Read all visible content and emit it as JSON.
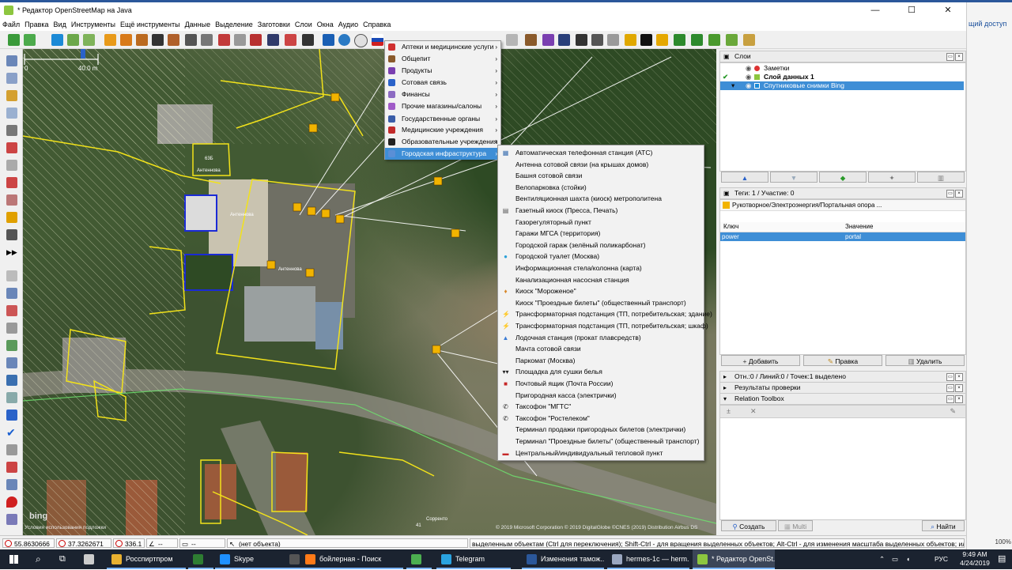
{
  "window": {
    "title": "* Редактор OpenStreetMap на Java",
    "minimize": "—",
    "maximize": "☐",
    "close": "✕"
  },
  "background_window": {
    "text": "щий доступ",
    "zoom": "100%"
  },
  "menubar": [
    "Файл",
    "Правка",
    "Вид",
    "Инструменты",
    "Ещё инструменты",
    "Данные",
    "Выделение",
    "Заготовки",
    "Слои",
    "Окна",
    "Аудио",
    "Справка"
  ],
  "map": {
    "scale_start": "0",
    "scale_end": "40.0 m",
    "attribution": "© 2019 Microsoft Corporation © 2019 DigitalGlobe ©CNES (2019) Distribution Airbus DS",
    "bing_logo": "bing",
    "terms": "Условия использования подложки",
    "labels": [
      "Антеннова",
      "Антеннова",
      "Антеннова",
      "Сорренто",
      "63Б",
      "41"
    ]
  },
  "presets_menu": {
    "items": [
      {
        "label": "Аптеки и медицинские услуги",
        "icon_color": "#d03030"
      },
      {
        "label": "Общепит",
        "icon_color": "#8a5a2b"
      },
      {
        "label": "Продукты",
        "icon_color": "#7a3fb0"
      },
      {
        "label": "Сотовая связь",
        "icon_color": "#2a62c9"
      },
      {
        "label": "Финансы",
        "icon_color": "#8c6bc2"
      },
      {
        "label": "Прочие магазины/салоны",
        "icon_color": "#a05bc8"
      },
      {
        "label": "Государственные органы",
        "icon_color": "#3a5da8"
      },
      {
        "label": "Медицинские учреждения",
        "icon_color": "#c22b2b"
      },
      {
        "label": "Образовательные учреждения",
        "icon_color": "#222222"
      },
      {
        "label": "Городская инфраструктура",
        "icon_color": "#5a8fd6"
      }
    ],
    "arrow": "›"
  },
  "submenu": {
    "items": [
      {
        "label": "Автоматическая телефонная станция (АТС)",
        "icon": "▦",
        "icon_color": "#3a6fb0"
      },
      {
        "label": "Антенна сотовой связи (на крышах домов)",
        "icon": "",
        "icon_color": ""
      },
      {
        "label": "Башня сотовой связи",
        "icon": "",
        "icon_color": ""
      },
      {
        "label": "Велопарковка (стойки)",
        "icon": "",
        "icon_color": ""
      },
      {
        "label": "Вентиляционная шахта (киоск) метрополитена",
        "icon": "",
        "icon_color": ""
      },
      {
        "label": "Газетный киоск (Пресса, Печать)",
        "icon": "▤",
        "icon_color": "#555555"
      },
      {
        "label": "Газорегуляторный пункт",
        "icon": "",
        "icon_color": ""
      },
      {
        "label": "Гаражи МГСА (территория)",
        "icon": "",
        "icon_color": ""
      },
      {
        "label": "Городской гараж (зелёный поликарбонат)",
        "icon": "",
        "icon_color": ""
      },
      {
        "label": "Городской туалет (Москва)",
        "icon": "●",
        "icon_color": "#2aa0d8"
      },
      {
        "label": "Информационная стела/колонна (карта)",
        "icon": "",
        "icon_color": ""
      },
      {
        "label": "Канализационная насосная станция",
        "icon": "",
        "icon_color": ""
      },
      {
        "label": "Киоск \"Мороженое\"",
        "icon": "♦",
        "icon_color": "#d8882a"
      },
      {
        "label": "Киоск \"Проездные билеты\" (общественный транспорт)",
        "icon": "",
        "icon_color": ""
      },
      {
        "label": "Трансформаторная подстанция (ТП, потребительская; здание)",
        "icon": "⚡",
        "icon_color": "#e0a800"
      },
      {
        "label": "Трансформаторная подстанция (ТП, потребительская; шкаф)",
        "icon": "⚡",
        "icon_color": "#e0a800"
      },
      {
        "label": "Лодочная станция (прокат плавсредств)",
        "icon": "▲",
        "icon_color": "#3a7bd5"
      },
      {
        "label": "Мачта сотовой связи",
        "icon": "",
        "icon_color": ""
      },
      {
        "label": "Паркомат (Москва)",
        "icon": "",
        "icon_color": ""
      },
      {
        "label": "Площадка для сушки белья",
        "icon": "▾▾",
        "icon_color": "#222222"
      },
      {
        "label": "Почтовый ящик (Почта России)",
        "icon": "■",
        "icon_color": "#c62828"
      },
      {
        "label": "Пригородная касса (электрички)",
        "icon": "",
        "icon_color": ""
      },
      {
        "label": "Таксофон \"МГТС\"",
        "icon": "✆",
        "icon_color": "#222222"
      },
      {
        "label": "Таксофон \"Ростелеком\"",
        "icon": "✆",
        "icon_color": "#222222"
      },
      {
        "label": "Терминал продажи пригородных билетов (электрички)",
        "icon": "",
        "icon_color": ""
      },
      {
        "label": "Терминал \"Проездные билеты\" (общественный транспорт)",
        "icon": "",
        "icon_color": ""
      },
      {
        "label": "Центральный/индивидуальный тепловой пункт",
        "icon": "▬",
        "icon_color": "#c62828"
      }
    ]
  },
  "layers_panel": {
    "title": "Слои",
    "layers": [
      {
        "name": "Заметки",
        "bold": false,
        "selected": false
      },
      {
        "name": "Слой данных 1",
        "bold": true,
        "selected": false
      },
      {
        "name": "Спутниковые снимки Bing",
        "bold": false,
        "selected": true
      }
    ]
  },
  "tags_panel": {
    "title": "Теги: 1 / Участие: 0",
    "preset": "Рукотворное/Электроэнергия/Портальная опора ...",
    "col_key": "Ключ",
    "col_value": "Значение",
    "rows": [
      {
        "key": "power",
        "value": "portal"
      }
    ],
    "add": "Добавить",
    "edit": "Правка",
    "delete": "Удалить"
  },
  "relations_panel": {
    "title": "Отн.:0 / Линий:0 / Точек:1 выделено"
  },
  "validation_panel": {
    "title": "Результаты проверки"
  },
  "relation_toolbox": {
    "title": "Relation Toolbox",
    "create": "Создать",
    "multi": "Multi",
    "find": "Найти"
  },
  "statusbar": {
    "lat": "55.8630666",
    "lon": "37.3262671",
    "heading": "336.1 °",
    "angle": "--",
    "length": "--",
    "object": "(нет объекта)",
    "help": "выделенным объектам (Ctrl для переключения); Shift-Ctrl - для вращения выделенных объектов; Alt-Ctrl - для изменения масштаба выделенных объектов; или для изменения выдел"
  },
  "taskbar": {
    "apps": [
      {
        "label": "Росспиртпром",
        "color": "#e8b030",
        "active": false
      },
      {
        "label": "",
        "color": "#2e7d32",
        "active": false
      },
      {
        "label": "Skype",
        "color": "#1e90ff",
        "active": false
      },
      {
        "label": "",
        "color": "#555555",
        "active": false
      },
      {
        "label": "бойлерная - Поиск",
        "color": "#ff7a18",
        "active": false
      },
      {
        "label": "",
        "color": "#4caf50",
        "active": false
      },
      {
        "label": "Telegram",
        "color": "#2aa3e0",
        "active": false
      },
      {
        "label": "Изменения тамож...",
        "color": "#2b579a",
        "active": false
      },
      {
        "label": "hermes-1c — herm...",
        "color": "#9aa7c0",
        "active": false
      },
      {
        "label": "* Редактор OpenSt...",
        "color": "#8dc63f",
        "active": true
      }
    ],
    "time": "9:49 AM",
    "date": "4/24/2019",
    "lang": "РУС"
  }
}
